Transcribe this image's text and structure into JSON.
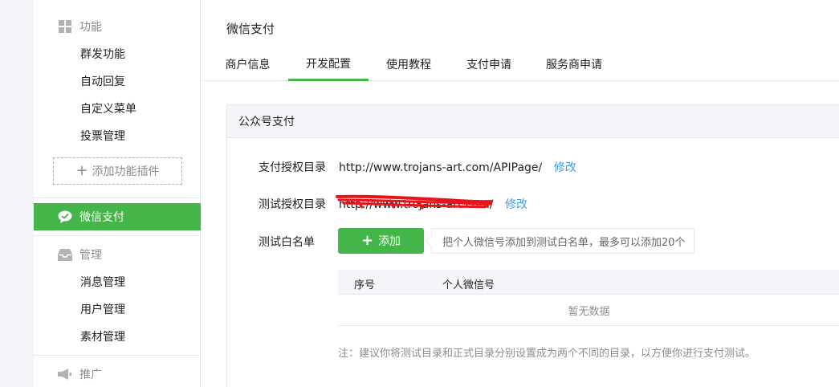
{
  "sidebar": {
    "functions": {
      "title": "功能",
      "icon": "grid-icon",
      "items": [
        "群发功能",
        "自动回复",
        "自定义菜单",
        "投票管理"
      ],
      "add_plugin": "添加功能插件"
    },
    "active": {
      "label": "微信支付",
      "icon": "wechat-pay-icon"
    },
    "manage": {
      "title": "管理",
      "icon": "inbox-icon",
      "items": [
        "消息管理",
        "用户管理",
        "素材管理"
      ]
    },
    "promote": {
      "title": "推广",
      "icon": "megaphone-icon"
    }
  },
  "main": {
    "title": "微信支付",
    "tabs": [
      {
        "label": "商户信息"
      },
      {
        "label": "开发配置",
        "active": true
      },
      {
        "label": "使用教程"
      },
      {
        "label": "支付申请"
      },
      {
        "label": "服务商申请"
      }
    ],
    "panel": {
      "heading": "公众号支付",
      "pay_dir": {
        "label": "支付授权目录",
        "value": "http://www.trojans-art.com/APIPage/",
        "action": "修改"
      },
      "test_dir": {
        "label": "测试授权目录",
        "value": "http://www.trojans-art.com/",
        "action": "修改"
      },
      "whitelist": {
        "label": "测试白名单",
        "add_button": "添加",
        "hint": "把个人微信号添加到测试白名单，最多可以添加20个",
        "columns": [
          "序号",
          "个人微信号"
        ],
        "empty": "暂无数据"
      },
      "note": "注：建议你将测试目录和正式目录分别设置成为两个不同的目录，以方便你进行支付测试。"
    }
  },
  "colors": {
    "accent": "#44b549",
    "link": "#459ae9",
    "scribble": "#e8141b"
  }
}
